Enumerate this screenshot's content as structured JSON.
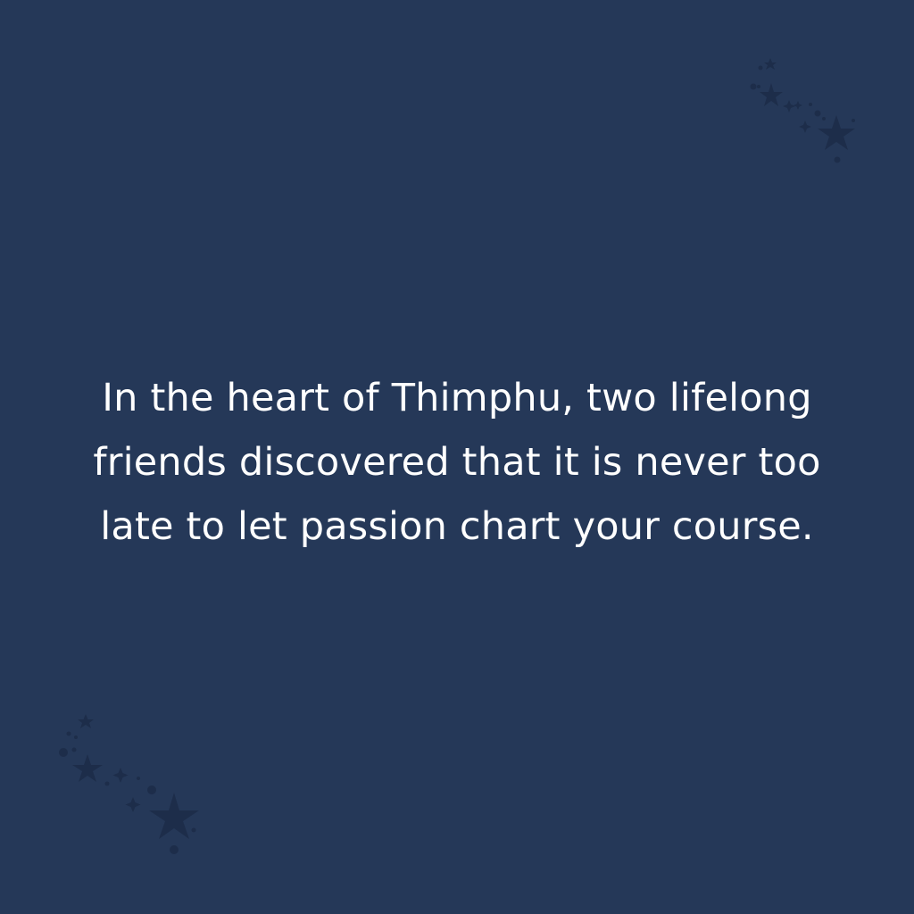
{
  "background_color": "#253858",
  "star_color": "#1d2d4a",
  "text_color": "#ffffff",
  "story": {
    "line1": "In the heart of Thimphu, two lifelong",
    "line2": "friends discovered that it is never too",
    "line3": "late to let passion chart your course."
  },
  "decorations": {
    "top_right": "stars-icon",
    "bottom_left": "stars-icon"
  }
}
